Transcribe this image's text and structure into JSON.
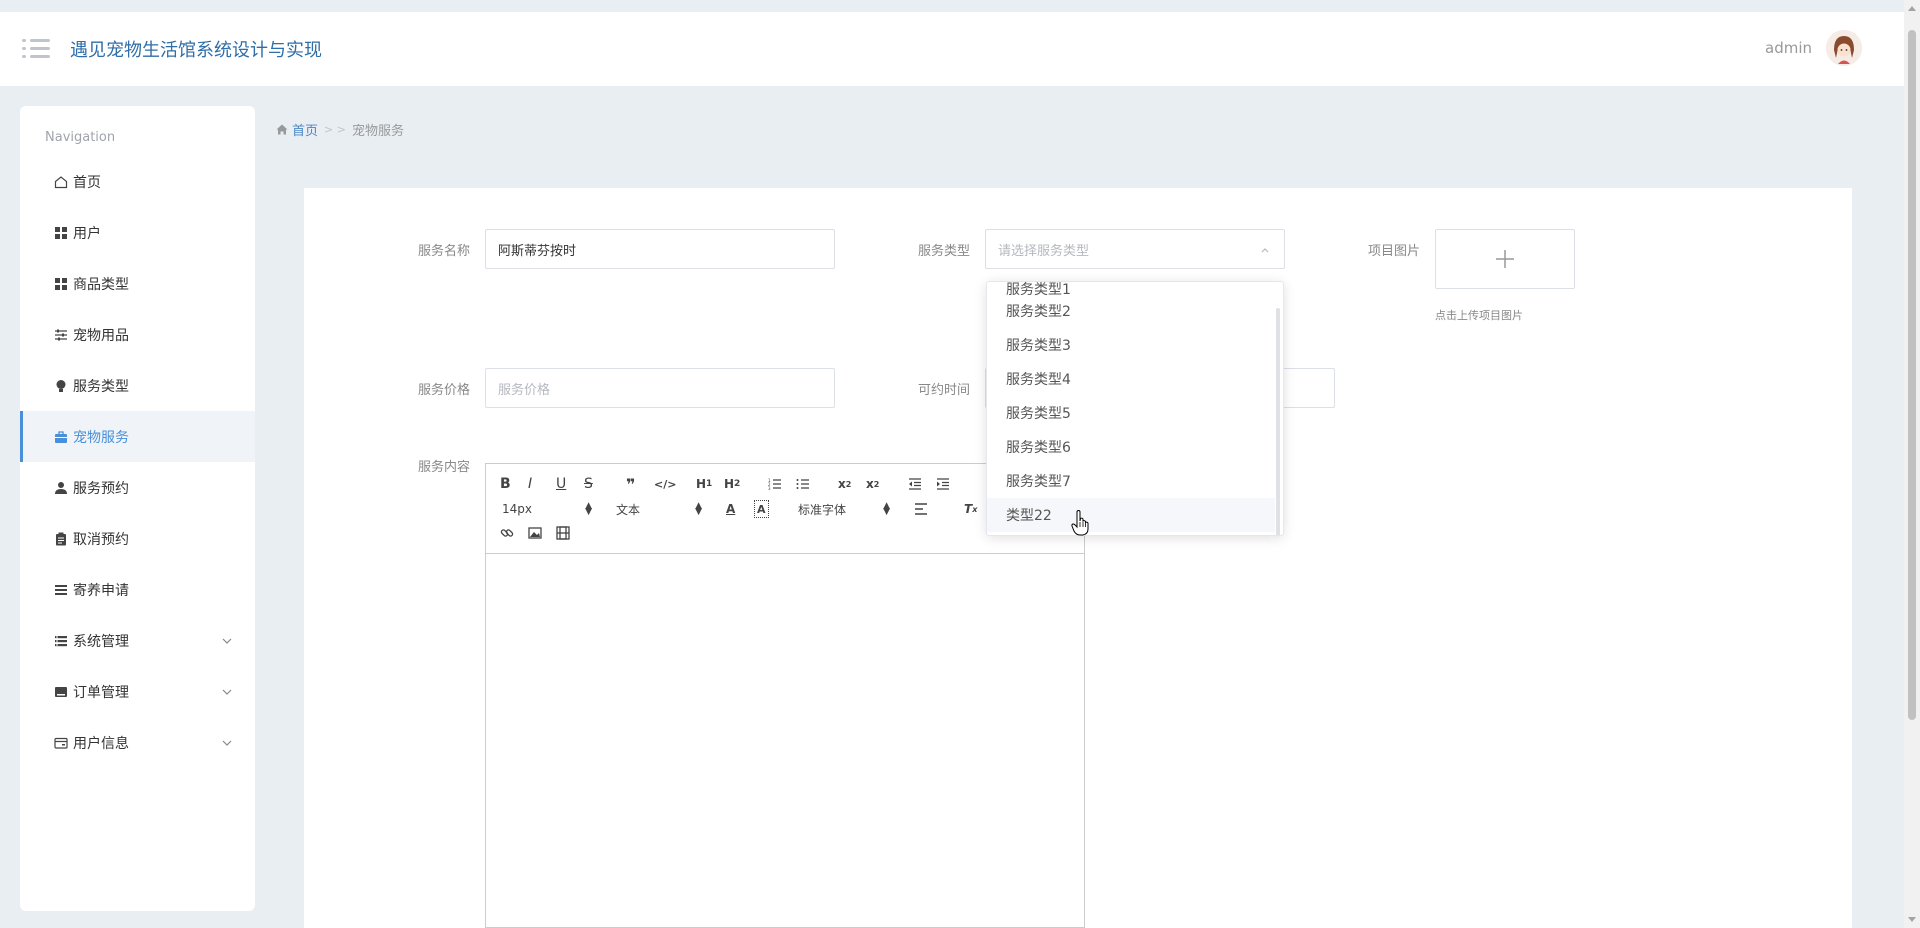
{
  "header": {
    "title": "遇见宠物生活馆系统设计与实现",
    "user_name": "admin"
  },
  "sidebar": {
    "nav_title": "Navigation",
    "items": [
      {
        "label": "首页",
        "icon": "home-icon"
      },
      {
        "label": "用户",
        "icon": "grid-icon"
      },
      {
        "label": "商品类型",
        "icon": "grid-icon"
      },
      {
        "label": "宠物用品",
        "icon": "sliders-icon"
      },
      {
        "label": "服务类型",
        "icon": "bulb-icon"
      },
      {
        "label": "宠物服务",
        "icon": "briefcase-icon",
        "active": true
      },
      {
        "label": "服务预约",
        "icon": "user-icon"
      },
      {
        "label": "取消预约",
        "icon": "clipboard-icon"
      },
      {
        "label": "寄养申请",
        "icon": "list-icon"
      },
      {
        "label": "系统管理",
        "icon": "menu-icon",
        "expandable": true
      },
      {
        "label": "订单管理",
        "icon": "inbox-icon",
        "expandable": true
      },
      {
        "label": "用户信息",
        "icon": "card-icon",
        "expandable": true
      }
    ]
  },
  "breadcrumb": {
    "home": "首页",
    "separator": "> >",
    "current": "宠物服务"
  },
  "form": {
    "service_name_label": "服务名称",
    "service_name_value": "阿斯蒂芬按时",
    "service_type_label": "服务类型",
    "service_type_placeholder": "请选择服务类型",
    "project_image_label": "项目图片",
    "upload_hint": "点击上传项目图片",
    "service_price_label": "服务价格",
    "service_price_placeholder": "服务价格",
    "bookable_time_label": "可约时间",
    "service_content_label": "服务内容"
  },
  "editor": {
    "font_size": "14px",
    "text_style": "文本",
    "font_family": "标准字体"
  },
  "dropdown": {
    "partial_item": "服务类型1",
    "items": [
      "服务类型2",
      "服务类型3",
      "服务类型4",
      "服务类型5",
      "服务类型6",
      "服务类型7",
      "类型22"
    ],
    "hovered": "类型22"
  },
  "colors": {
    "accent": "#4a90d9",
    "title": "#2f6ea8",
    "background": "#e9eef3"
  }
}
